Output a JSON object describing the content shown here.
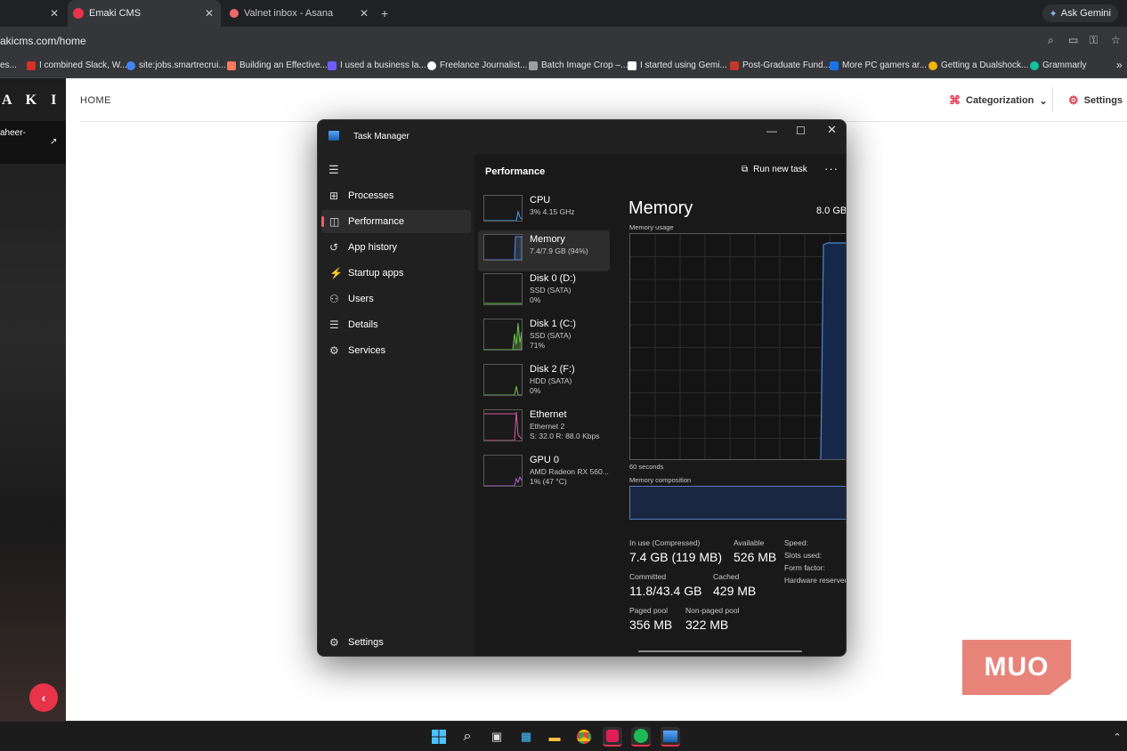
{
  "browser": {
    "tabs": [
      {
        "label": "",
        "active": false
      },
      {
        "label": "Emaki CMS",
        "active": true
      },
      {
        "label": "Valnet inbox - Asana",
        "active": false
      }
    ],
    "new_tab": "+",
    "ask_gemini": "Ask Gemini",
    "url": "akicms.com/home",
    "bookmarks": [
      {
        "label": "es...",
        "color": "#444"
      },
      {
        "label": "I combined Slack, W...",
        "color": "#d93025"
      },
      {
        "label": "site:jobs.smartrecrui...",
        "color": "#4285f4"
      },
      {
        "label": "Building an Effective...",
        "color": "#ff7a59"
      },
      {
        "label": "I used a business la...",
        "color": "#6d5dfc"
      },
      {
        "label": "Freelance Journalist...",
        "color": "#ffffff"
      },
      {
        "label": "Batch Image Crop –...",
        "color": "#9e9e9e"
      },
      {
        "label": "I started using Gemi...",
        "color": "#ffffff"
      },
      {
        "label": "Post-Graduate Fund...",
        "color": "#c0392b"
      },
      {
        "label": "More PC gamers ar...",
        "color": "#1a73e8"
      },
      {
        "label": "Getting a Dualshock...",
        "color": "#f4b400"
      },
      {
        "label": "Grammarly",
        "color": "#15c39a"
      }
    ],
    "bookmarks_more": "»"
  },
  "cms": {
    "logo": "A K I",
    "user": "aheer-",
    "home": "HOME",
    "categorization": "Categorization",
    "settings": "Settings"
  },
  "task_manager": {
    "title": "Task Manager",
    "nav": [
      {
        "label": "Processes",
        "icon": "processes-icon",
        "glyph": "⊞"
      },
      {
        "label": "Performance",
        "icon": "performance-icon",
        "glyph": "◫"
      },
      {
        "label": "App history",
        "icon": "history-icon",
        "glyph": "↺"
      },
      {
        "label": "Startup apps",
        "icon": "startup-icon",
        "glyph": "⚡"
      },
      {
        "label": "Users",
        "icon": "users-icon",
        "glyph": "⚇"
      },
      {
        "label": "Details",
        "icon": "details-icon",
        "glyph": "☰"
      },
      {
        "label": "Services",
        "icon": "services-icon",
        "glyph": "⚙"
      }
    ],
    "nav_settings": "Settings",
    "header": "Performance",
    "run_new_task": "Run new task",
    "devices": [
      {
        "name": "CPU",
        "s1": "3% 4.15 GHz",
        "s2": "",
        "color": "#3fa9f5"
      },
      {
        "name": "Memory",
        "s1": "7.4/7.9 GB (94%)",
        "s2": "",
        "color": "#5b8bd8"
      },
      {
        "name": "Disk 0 (D:)",
        "s1": "SSD (SATA)",
        "s2": "0%",
        "color": "#6cc04a"
      },
      {
        "name": "Disk 1 (C:)",
        "s1": "SSD (SATA)",
        "s2": "71%",
        "color": "#6cc04a"
      },
      {
        "name": "Disk 2 (F:)",
        "s1": "HDD (SATA)",
        "s2": "0%",
        "color": "#6cc04a"
      },
      {
        "name": "Ethernet",
        "s1": "Ethernet 2",
        "s2": "S: 32.0 R: 88.0 Kbps",
        "color": "#d75a9c"
      },
      {
        "name": "GPU 0",
        "s1": "AMD Radeon RX 560...",
        "s2": "1% (47 °C)",
        "color": "#b55fd4"
      }
    ],
    "memory": {
      "title": "Memory",
      "total": "8.0 GB",
      "usage_label": "Memory usage",
      "window_label": "60 seconds",
      "composition_label": "Memory composition",
      "stats": [
        {
          "label": "In use (Compressed)",
          "value": "7.4 GB (119 MB)"
        },
        {
          "label": "Available",
          "value": "526 MB"
        },
        {
          "label": "Committed",
          "value": "11.8/43.4 GB"
        },
        {
          "label": "Cached",
          "value": "429 MB"
        },
        {
          "label": "Paged pool",
          "value": "356 MB"
        },
        {
          "label": "Non-paged pool",
          "value": "322 MB"
        }
      ],
      "side_labels": [
        "Speed:",
        "Slots used:",
        "Form factor:",
        "Hardware reserved"
      ]
    }
  },
  "watermark": "MUO",
  "colors": {
    "accent_red": "#e8334a",
    "memory_blue": "#5b8bd8",
    "nav_indicator": "#ff5a67"
  }
}
